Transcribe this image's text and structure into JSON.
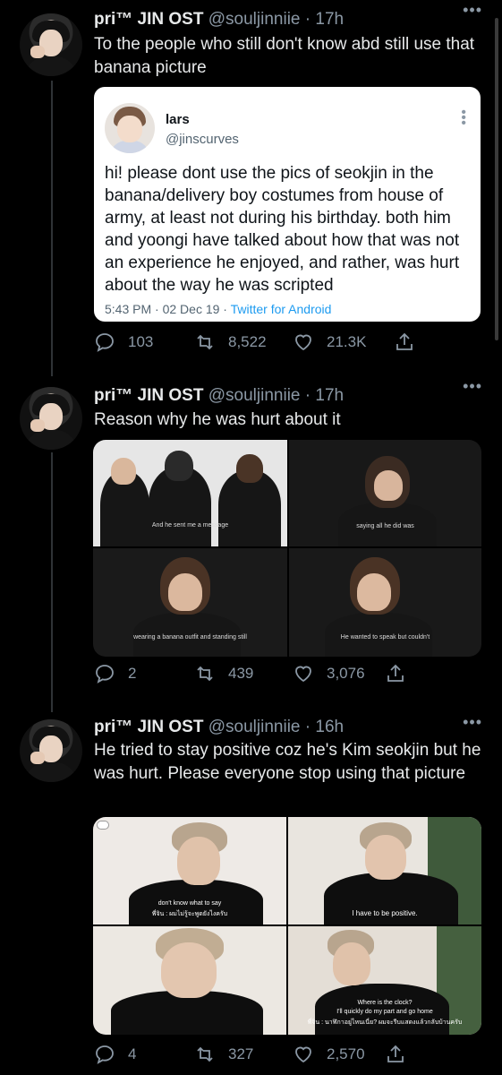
{
  "tweets": [
    {
      "name": "pri™ JIN OST",
      "handle": "@souljinniie",
      "time": "· 17h",
      "text": "To the people who still don't know abd still use that banana picture",
      "quote": {
        "name": "lars",
        "handle": "@jinscurves",
        "text": "hi! please dont use the pics of seokjin in the banana/delivery boy costumes from house of army, at least not during his birthday. both him and yoongi have talked about how that was not an experience he enjoyed, and rather, was hurt about the way he was scripted",
        "time": "5:43 PM · 02 Dec 19 · ",
        "source": "Twitter for Android"
      },
      "stats": {
        "replies": "103",
        "retweets": "8,522",
        "likes": "21.3K"
      }
    },
    {
      "name": "pri™ JIN OST",
      "handle": "@souljinniie",
      "time": "· 17h",
      "text": "Reason why he was hurt about it",
      "captions": [
        "And he sent me a message",
        "saying all he did was",
        "wearing a banana outfit and standing still",
        "He wanted to speak but couldn't"
      ],
      "stats": {
        "replies": "2",
        "retweets": "439",
        "likes": "3,076"
      }
    },
    {
      "name": "pri™ JIN OST",
      "handle": "@souljinniie",
      "time": "· 16h",
      "text": "He tried to stay positive coz he's Kim seokjin but he was hurt. Please everyone stop using that picture",
      "captions": [
        "don't know what to say",
        "I have to be positive.",
        "Where is the clock?",
        "I'll quickly do my part and go home"
      ],
      "captions_th": [
        "พี่จิน : ผมไม่รู้จะพูดยังไงครับ",
        "พี่จิน : นาฬิกาอยู่ไหนเนี่ย? ผมจะรีบแสดงแล้วกลับบ้านครับ"
      ],
      "stats": {
        "replies": "4",
        "retweets": "327",
        "likes": "2,570"
      }
    }
  ],
  "colors": {
    "background": "#000000",
    "text": "#e7e9ea",
    "muted": "#8b98a5",
    "link": "#1d9bf0",
    "thread": "#2f3336"
  }
}
